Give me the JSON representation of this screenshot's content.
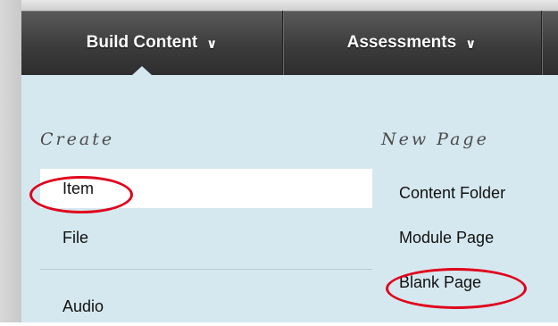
{
  "toolbar": {
    "build_content_label": "Build Content",
    "assessments_label": "Assessments",
    "chevron_glyph": "⌵"
  },
  "menu": {
    "create_heading": "Create",
    "new_page_heading": "New Page",
    "create_items": [
      "Item",
      "File",
      "Audio"
    ],
    "new_page_items": [
      "Content Folder",
      "Module Page",
      "Blank Page"
    ]
  },
  "annotations": {
    "circled_items": [
      "Item",
      "Blank Page"
    ],
    "color": "#e0001b"
  },
  "colors": {
    "toolbar_dark": "#3c3c3c",
    "menu_background": "#d5e8ef",
    "highlight": "#ffffff"
  }
}
